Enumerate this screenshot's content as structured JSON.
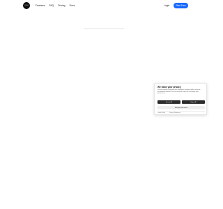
{
  "header": {
    "logo_text": "LOGO",
    "nav": [
      "Features",
      "FAQ",
      "Pricing",
      "Docs"
    ],
    "login_label": "Login",
    "cta_label": "Start Free"
  },
  "cookie": {
    "title": "We value your privacy",
    "body": "We use cookies to improve your experience, analyze traffic and serve personalized content. You can accept all, reject all or manage your preferences.",
    "accept_label": "Accept All",
    "reject_label": "Reject All",
    "manage_label": "Manage preferences",
    "links": [
      "Cookie Policy",
      "Privacy Preferences"
    ]
  },
  "colors": {
    "accent": "#1769ff",
    "dark_button": "#2b2b2b"
  }
}
